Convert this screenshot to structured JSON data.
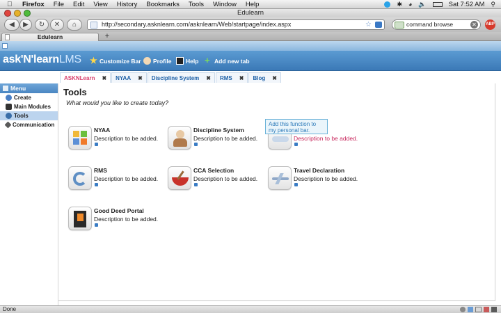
{
  "os_menubar": {
    "app": "Firefox",
    "items": [
      "File",
      "Edit",
      "View",
      "History",
      "Bookmarks",
      "Tools",
      "Window",
      "Help"
    ],
    "clock": "Sat 7:52 AM"
  },
  "window": {
    "title": "Edulearn"
  },
  "toolbar": {
    "url": "http://secondary.asknlearn.com/asknlearn/Web/startpage/index.aspx",
    "search_value": "command browse"
  },
  "browser_tabs": [
    {
      "label": "Edulearn"
    }
  ],
  "app": {
    "logo_main": "ask'N'learn",
    "logo_suffix": "LMS",
    "header_buttons": [
      {
        "label": "Customize Bar",
        "icon": "star-icon"
      },
      {
        "label": "Profile",
        "icon": "person-icon"
      },
      {
        "label": "Help",
        "icon": "help-icon"
      },
      {
        "label": "Add new tab",
        "icon": "plus-icon"
      }
    ]
  },
  "content_tabs": [
    {
      "label": "ASKNLearn",
      "active": true
    },
    {
      "label": "NYAA",
      "active": false
    },
    {
      "label": "Discipline System",
      "active": false
    },
    {
      "label": "RMS",
      "active": false
    },
    {
      "label": "Blog",
      "active": false
    }
  ],
  "sidebar": {
    "header": "Menu",
    "items": [
      {
        "label": "Create",
        "active": false
      },
      {
        "label": "Main Modules",
        "active": false
      },
      {
        "label": "Tools",
        "active": true
      },
      {
        "label": "Communication",
        "active": false
      }
    ]
  },
  "main": {
    "title": "Tools",
    "subtitle": "What would you like to create today?",
    "tooltip": "Add this function to my personal bar.",
    "tools": [
      {
        "name": "NYAA",
        "desc": "Description to be added."
      },
      {
        "name": "Discipline System",
        "desc": "Description to be added."
      },
      {
        "name": "",
        "desc": "Description to be added."
      },
      {
        "name": "RMS",
        "desc": "Description to be added."
      },
      {
        "name": "CCA Selection",
        "desc": "Description to be added."
      },
      {
        "name": "Travel Declaration",
        "desc": "Description to be added."
      },
      {
        "name": "Good Deed Portal",
        "desc": "Description to be added."
      }
    ]
  },
  "statusbar": {
    "text": "Done"
  },
  "colors": {
    "header_blue": "#3b79b7",
    "tab_active_pink": "#d8406d",
    "link_blue": "#1c5fa6"
  }
}
